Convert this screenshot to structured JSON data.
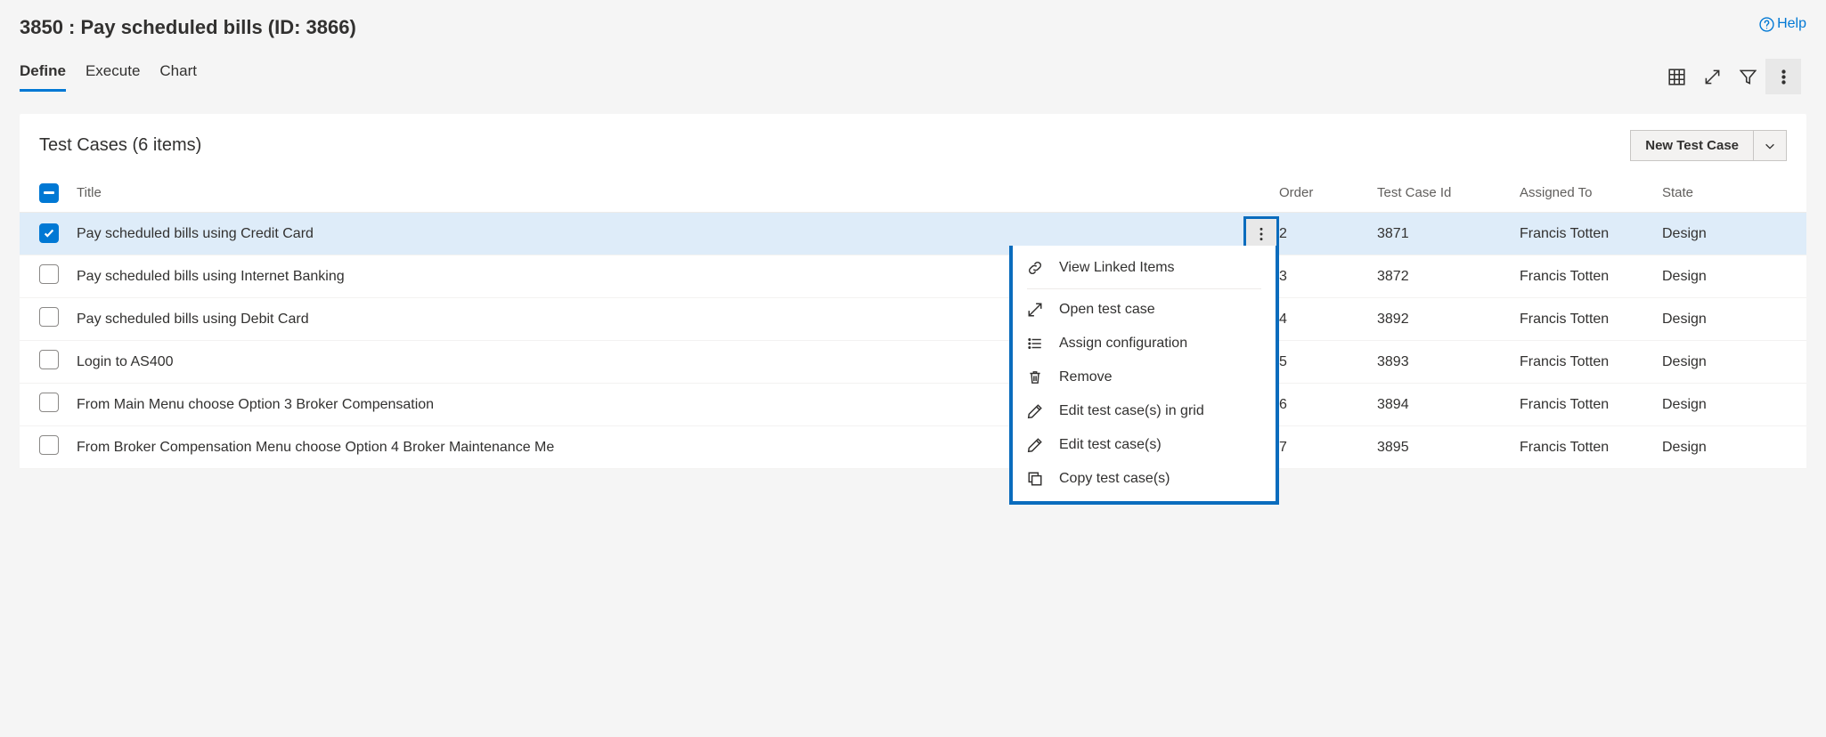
{
  "page_title": "3850 : Pay scheduled bills (ID: 3866)",
  "help_label": "Help",
  "tabs": [
    {
      "label": "Define",
      "active": true
    },
    {
      "label": "Execute",
      "active": false
    },
    {
      "label": "Chart",
      "active": false
    }
  ],
  "card_title": "Test Cases (6 items)",
  "new_button_label": "New Test Case",
  "columns": {
    "title": "Title",
    "order": "Order",
    "tcid": "Test Case Id",
    "assigned": "Assigned To",
    "state": "State"
  },
  "rows": [
    {
      "title": "Pay scheduled bills using Credit Card",
      "order": "2",
      "tcid": "3871",
      "assigned": "Francis Totten",
      "state": "Design",
      "selected": true
    },
    {
      "title": "Pay scheduled bills using Internet Banking",
      "order": "3",
      "tcid": "3872",
      "assigned": "Francis Totten",
      "state": "Design",
      "selected": false
    },
    {
      "title": "Pay scheduled bills using Debit Card",
      "order": "4",
      "tcid": "3892",
      "assigned": "Francis Totten",
      "state": "Design",
      "selected": false
    },
    {
      "title": "Login to AS400",
      "order": "5",
      "tcid": "3893",
      "assigned": "Francis Totten",
      "state": "Design",
      "selected": false
    },
    {
      "title": "From Main Menu choose Option 3 Broker Compensation",
      "order": "6",
      "tcid": "3894",
      "assigned": "Francis Totten",
      "state": "Design",
      "selected": false
    },
    {
      "title": "From Broker Compensation Menu choose Option 4 Broker Maintenance Me",
      "order": "7",
      "tcid": "3895",
      "assigned": "Francis Totten",
      "state": "Design",
      "selected": false
    }
  ],
  "context_menu": [
    {
      "label": "View Linked Items",
      "icon": "link"
    },
    {
      "sep": true
    },
    {
      "label": "Open test case",
      "icon": "open"
    },
    {
      "label": "Assign configuration",
      "icon": "list"
    },
    {
      "label": "Remove",
      "icon": "trash"
    },
    {
      "label": "Edit test case(s) in grid",
      "icon": "pencil"
    },
    {
      "label": "Edit test case(s)",
      "icon": "pencil"
    },
    {
      "label": "Copy test case(s)",
      "icon": "copy"
    }
  ]
}
